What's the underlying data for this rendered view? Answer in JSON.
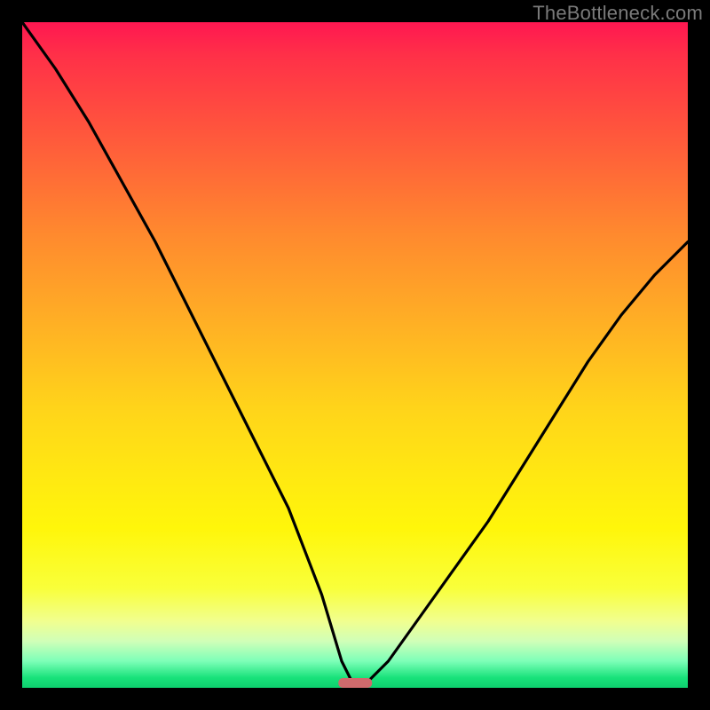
{
  "watermark": "TheBottleneck.com",
  "chart_data": {
    "type": "line",
    "title": "",
    "xlabel": "",
    "ylabel": "",
    "xlim": [
      0,
      100
    ],
    "ylim": [
      0,
      100
    ],
    "grid": false,
    "legend": false,
    "background_gradient": {
      "direction": "vertical",
      "stops": [
        {
          "pos": 0,
          "color": "#ff1751"
        },
        {
          "pos": 18,
          "color": "#ff5b3b"
        },
        {
          "pos": 46,
          "color": "#ffb224"
        },
        {
          "pos": 76,
          "color": "#fff60a"
        },
        {
          "pos": 93,
          "color": "#d0ffb8"
        },
        {
          "pos": 100,
          "color": "#0ecf6e"
        }
      ]
    },
    "series": [
      {
        "name": "bottleneck-curve",
        "color": "#000000",
        "x": [
          0,
          5,
          10,
          15,
          20,
          25,
          30,
          35,
          40,
          45,
          48,
          50,
          52,
          55,
          60,
          65,
          70,
          75,
          80,
          85,
          90,
          95,
          100
        ],
        "y": [
          100,
          93,
          85,
          76,
          67,
          57,
          47,
          37,
          27,
          14,
          4,
          0,
          1,
          4,
          11,
          18,
          25,
          33,
          41,
          49,
          56,
          62,
          67
        ]
      }
    ],
    "marker": {
      "name": "optimal-range",
      "x_center": 50,
      "width_pct": 5,
      "color": "#cf6a6c"
    }
  }
}
